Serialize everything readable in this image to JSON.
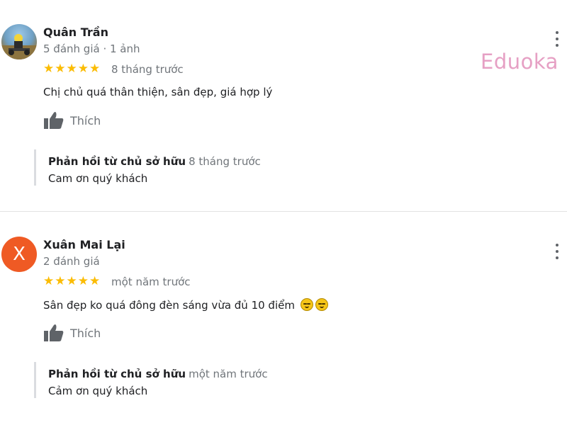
{
  "watermark": "Eduoka",
  "like_label": "Thích",
  "reviews": [
    {
      "name": "Quân Trần",
      "meta": "5 đánh giá · 1 ảnh",
      "avatar": "photo",
      "rating": 5,
      "time": "8 tháng trước",
      "text": "Chị chủ quá thân thiện, sân đẹp, giá hợp lý",
      "reply": {
        "owner_label": "Phản hồi từ chủ sở hữu",
        "time": "8 tháng trước",
        "text": "Cam ơn quý khách"
      }
    },
    {
      "name": "Xuân Mai Lại",
      "meta": "2 đánh giá",
      "avatar": "X",
      "avatar_color": "#ef5a24",
      "rating": 5,
      "time": "một năm trước",
      "text": "Sân đẹp ko quá đông đèn sáng vừa đủ 10 điểm",
      "emojis": [
        "grinning-face-icon",
        "grinning-face-icon"
      ],
      "reply": {
        "owner_label": "Phản hồi từ chủ sở hữu",
        "time": "một năm trước",
        "text": "Cảm ơn quý khách"
      }
    }
  ],
  "colors": {
    "star": "#fbbc04",
    "muted_text": "#70757a",
    "avatar_x": "#ef5a24",
    "watermark": "#e6a0c4"
  }
}
